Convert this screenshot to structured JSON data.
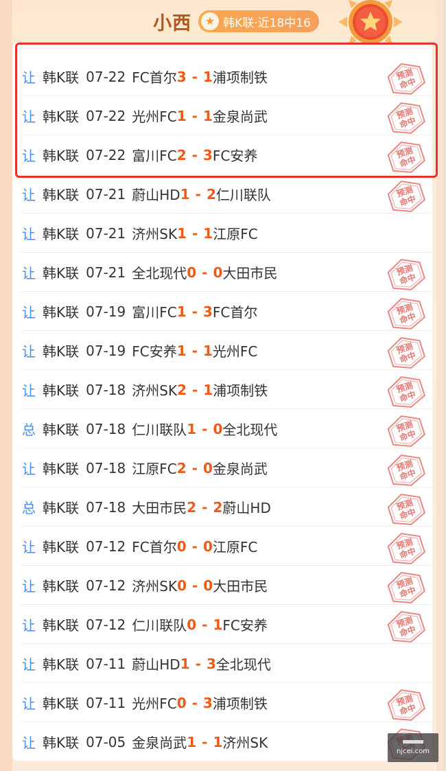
{
  "header": {
    "name": "小西",
    "badge_icon": "star-icon",
    "badge_text": "韩K联·近18中16"
  },
  "stamp_text": [
    "预测",
    "命中"
  ],
  "watermark": {
    "site": "njcei.com"
  },
  "matches": [
    {
      "type": "让",
      "league": "韩K联",
      "date": "07-22",
      "home": "FC首尔",
      "home_score": "3",
      "away_score": "1",
      "away": "浦项制铁",
      "hit": true
    },
    {
      "type": "让",
      "league": "韩K联",
      "date": "07-22",
      "home": "光州FC",
      "home_score": "1",
      "away_score": "1",
      "away": "金泉尚武",
      "hit": true
    },
    {
      "type": "让",
      "league": "韩K联",
      "date": "07-22",
      "home": "富川FC",
      "home_score": "2",
      "away_score": "3",
      "away": "FC安养",
      "hit": true
    },
    {
      "type": "让",
      "league": "韩K联",
      "date": "07-21",
      "home": "蔚山HD",
      "home_score": "1",
      "away_score": "2",
      "away": "仁川联队",
      "hit": true
    },
    {
      "type": "让",
      "league": "韩K联",
      "date": "07-21",
      "home": "济州SK",
      "home_score": "1",
      "away_score": "1",
      "away": "江原FC",
      "hit": false
    },
    {
      "type": "让",
      "league": "韩K联",
      "date": "07-21",
      "home": "全北现代",
      "home_score": "0",
      "away_score": "0",
      "away": "大田市民",
      "hit": true
    },
    {
      "type": "让",
      "league": "韩K联",
      "date": "07-19",
      "home": "富川FC",
      "home_score": "1",
      "away_score": "3",
      "away": "FC首尔",
      "hit": true
    },
    {
      "type": "让",
      "league": "韩K联",
      "date": "07-19",
      "home": "FC安养",
      "home_score": "1",
      "away_score": "1",
      "away": "光州FC",
      "hit": true
    },
    {
      "type": "让",
      "league": "韩K联",
      "date": "07-18",
      "home": "济州SK",
      "home_score": "2",
      "away_score": "1",
      "away": "浦项制铁",
      "hit": true
    },
    {
      "type": "总",
      "league": "韩K联",
      "date": "07-18",
      "home": "仁川联队",
      "home_score": "1",
      "away_score": "0",
      "away": "全北现代",
      "hit": true
    },
    {
      "type": "让",
      "league": "韩K联",
      "date": "07-18",
      "home": "江原FC",
      "home_score": "2",
      "away_score": "0",
      "away": "金泉尚武",
      "hit": true
    },
    {
      "type": "总",
      "league": "韩K联",
      "date": "07-18",
      "home": "大田市民",
      "home_score": "2",
      "away_score": "2",
      "away": "蔚山HD",
      "hit": true
    },
    {
      "type": "让",
      "league": "韩K联",
      "date": "07-12",
      "home": "FC首尔",
      "home_score": "0",
      "away_score": "0",
      "away": "江原FC",
      "hit": true
    },
    {
      "type": "让",
      "league": "韩K联",
      "date": "07-12",
      "home": "济州SK",
      "home_score": "0",
      "away_score": "0",
      "away": "大田市民",
      "hit": true
    },
    {
      "type": "让",
      "league": "韩K联",
      "date": "07-12",
      "home": "仁川联队",
      "home_score": "0",
      "away_score": "1",
      "away": "FC安养",
      "hit": true
    },
    {
      "type": "让",
      "league": "韩K联",
      "date": "07-11",
      "home": "蔚山HD",
      "home_score": "1",
      "away_score": "3",
      "away": "全北现代",
      "hit": false
    },
    {
      "type": "让",
      "league": "韩K联",
      "date": "07-11",
      "home": "光州FC",
      "home_score": "0",
      "away_score": "3",
      "away": "浦项制铁",
      "hit": true
    },
    {
      "type": "让",
      "league": "韩K联",
      "date": "07-05",
      "home": "金泉尚武",
      "home_score": "1",
      "away_score": "1",
      "away": "济州SK",
      "hit": true
    }
  ],
  "colors": {
    "accent_orange": "#f05a18",
    "type_blue": "#4a8ce6",
    "highlight_red": "#e5322b",
    "name_brown": "#b5561b",
    "stamp_red": "#e0605a"
  }
}
